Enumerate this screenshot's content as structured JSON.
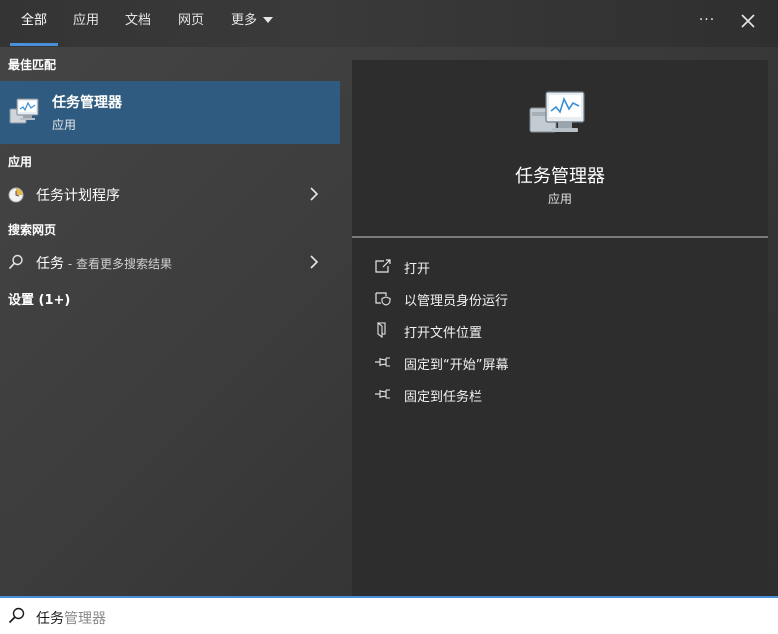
{
  "tabs": [
    {
      "label": "全部",
      "active": true
    },
    {
      "label": "应用"
    },
    {
      "label": "文档"
    },
    {
      "label": "网页"
    },
    {
      "label": "更多"
    }
  ],
  "top_actions": {
    "more_options": "···"
  },
  "best_match": {
    "header": "最佳匹配",
    "title": "任务管理器",
    "subtitle": "应用"
  },
  "apps": {
    "header": "应用",
    "items": [
      {
        "label": "任务计划程序"
      }
    ]
  },
  "web": {
    "header": "搜索网页",
    "item": {
      "label": "任务",
      "suffix": " - 查看更多搜索结果"
    }
  },
  "settings": {
    "header": "设置 (1+)"
  },
  "detail": {
    "title": "任务管理器",
    "subtitle": "应用",
    "actions": [
      {
        "label": "打开",
        "icon": "open-icon"
      },
      {
        "label": "以管理员身份运行",
        "icon": "shield-icon"
      },
      {
        "label": "打开文件位置",
        "icon": "file-location-icon"
      },
      {
        "label": "固定到“开始”屏幕",
        "icon": "pin-icon"
      },
      {
        "label": "固定到任务栏",
        "icon": "pin-icon"
      }
    ]
  },
  "search": {
    "typed": "任务",
    "suggestion": "管理器"
  },
  "colors": {
    "accent": "#4a90d9",
    "selected": "#2f5b80"
  }
}
